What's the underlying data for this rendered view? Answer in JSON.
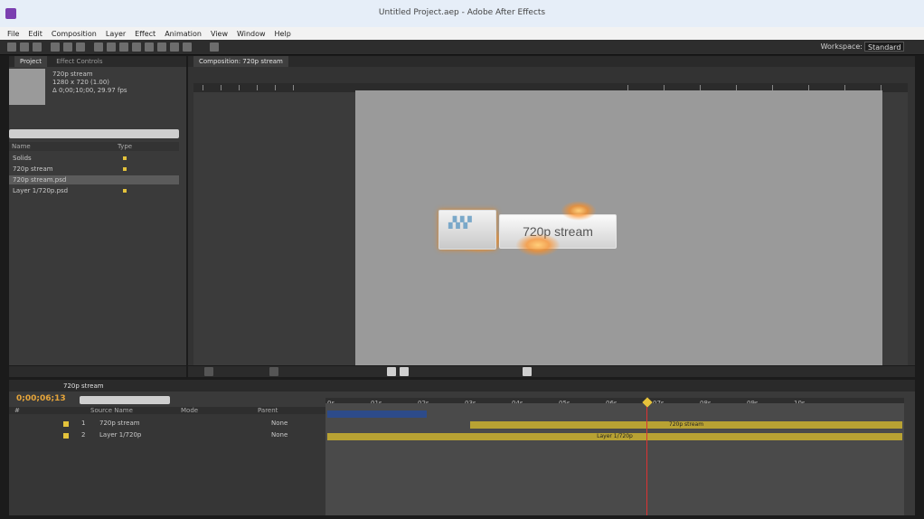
{
  "window": {
    "title": "Untitled Project.aep - Adobe After Effects"
  },
  "menu": [
    "File",
    "Edit",
    "Composition",
    "Layer",
    "Effect",
    "Animation",
    "View",
    "Window",
    "Help"
  ],
  "workspace": {
    "label": "Workspace:",
    "value": "Standard"
  },
  "project_panel": {
    "tabs": [
      "Project",
      "Effect Controls"
    ],
    "info_lines": [
      "720p stream",
      "1280 x 720 (1.00)",
      "Δ 0;00;10;00, 29.97 fps"
    ],
    "column_name": "Name",
    "column_type": "Type",
    "items": [
      "Solids",
      "720p stream",
      "720p stream.psd",
      "Layer 1/720p.psd"
    ]
  },
  "comp_panel": {
    "tab": "Composition: 720p stream",
    "lower_third_text": "720p stream"
  },
  "timeline": {
    "tab": "720p stream",
    "timecode": "0;00;06;13",
    "columns": [
      "#",
      "Source Name",
      "Mode",
      "Parent"
    ],
    "layers": [
      {
        "num": "1",
        "name": "720p stream",
        "parent": "None"
      },
      {
        "num": "2",
        "name": "Layer 1/720p",
        "parent": "None"
      }
    ],
    "ruler_labels": [
      "0s",
      "01s",
      "02s",
      "03s",
      "04s",
      "05s",
      "06s",
      "07s",
      "08s",
      "09s",
      "10s"
    ],
    "track_labels": [
      "720p stream",
      "Layer 1/720p"
    ]
  },
  "colors": {
    "accent": "#e6c23b",
    "track": "#b8a233",
    "selection": "#2d4b8a"
  }
}
